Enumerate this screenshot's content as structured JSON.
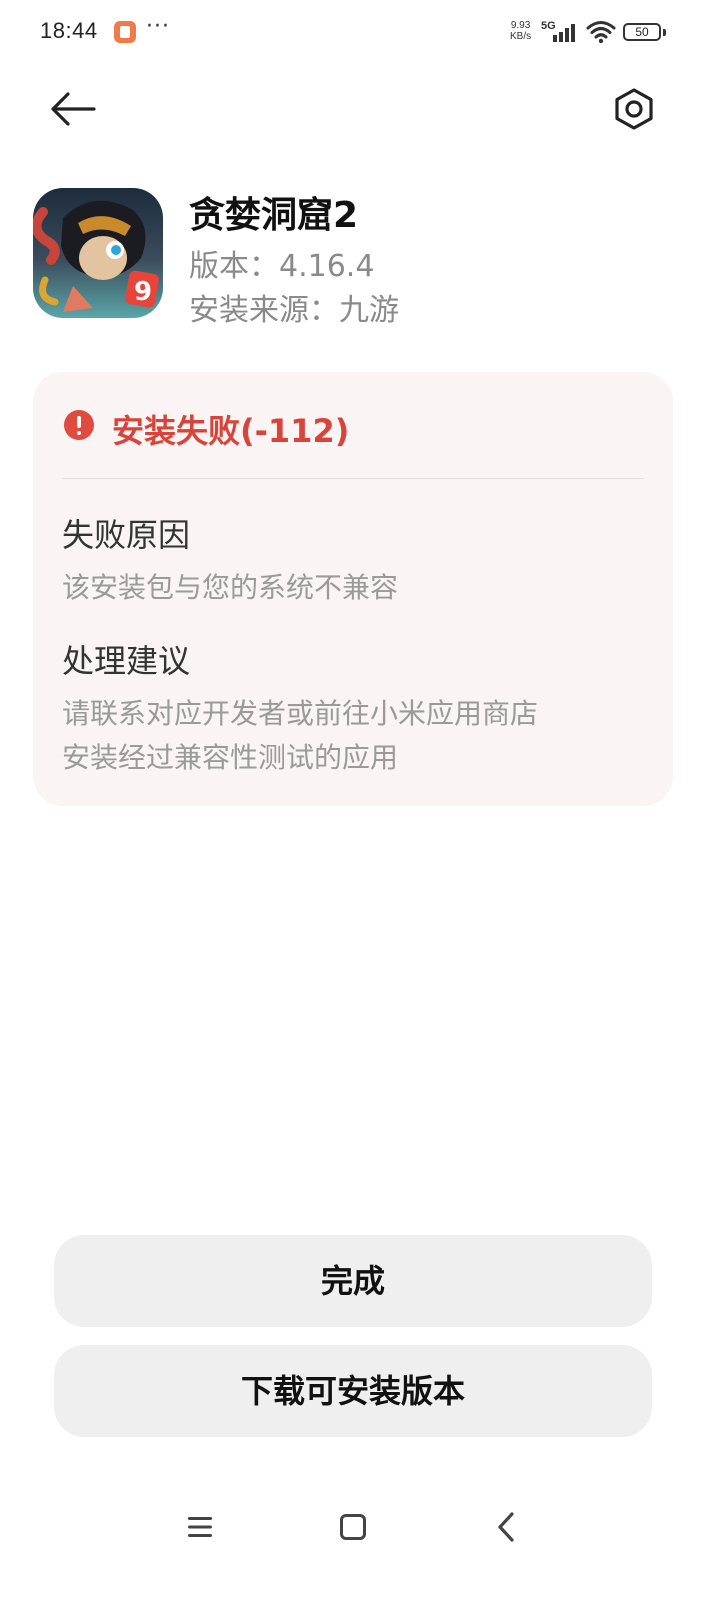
{
  "status_bar": {
    "time": "18:44",
    "more": "···",
    "net_speed_value": "9.93",
    "net_speed_unit": "KB/s",
    "network_type": "5G",
    "battery": "50"
  },
  "app": {
    "name": "贪婪洞窟2",
    "version": "版本：4.16.4",
    "source": "安装来源：九游",
    "icon_badge": "9"
  },
  "error": {
    "title": "安装失败(-112)",
    "reason_heading": "失败原因",
    "reason_text": "该安装包与您的系统不兼容",
    "suggestion_heading": "处理建议",
    "suggestion_line1": "请联系对应开发者或前往小米应用商店",
    "suggestion_line2": "安装经过兼容性测试的应用"
  },
  "buttons": {
    "done": "完成",
    "download": "下载可安装版本"
  },
  "colors": {
    "error_red": "#d9443a",
    "card_bg": "#fbf4f4",
    "button_bg": "#efefef"
  },
  "icons": [
    "back-arrow-icon",
    "settings-hexagon-icon",
    "error-exclamation-icon",
    "nav-menu-icon",
    "nav-home-icon",
    "nav-back-icon"
  ]
}
